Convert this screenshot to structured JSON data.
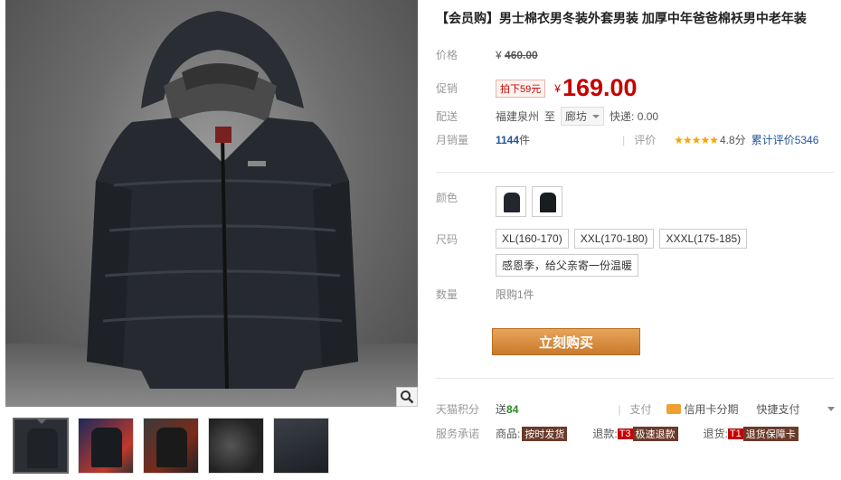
{
  "product": {
    "title": "【会员购】男士棉衣男冬装外套男装 加厚中年爸爸棉袄男中老年装"
  },
  "price": {
    "label": "价格",
    "currency": "¥",
    "original": "460.00"
  },
  "promo": {
    "label": "促销",
    "discount_badge": "拍下59元",
    "currency": "¥",
    "price": "169.00"
  },
  "shipping": {
    "label": "配送",
    "from": "福建泉州",
    "to_word": "至",
    "destination": "廊坊",
    "express": "快递: 0.00"
  },
  "sales": {
    "label": "月销量",
    "count": "1144",
    "unit": "件",
    "review_label": "评价",
    "stars": "★★★★★",
    "rating": "4.8分",
    "review_count": "累计评价5346"
  },
  "color": {
    "label": "颜色"
  },
  "size": {
    "label": "尺码",
    "options": [
      "XL(160-170)",
      "XXL(170-180)",
      "XXXL(175-185)"
    ],
    "extra_option": "感恩季，给父亲寄一份温暖"
  },
  "quantity": {
    "label": "数量",
    "limit": "限购1件"
  },
  "buy_button": "立刻购买",
  "points": {
    "label": "天猫积分",
    "give": "送",
    "amount": "84"
  },
  "payment": {
    "label": "支付",
    "credit": "信用卡分期",
    "quick": "快捷支付"
  },
  "service": {
    "label": "服务承诺",
    "goods": "商品:",
    "goods_tag": "按时发货",
    "refund": "退款:",
    "refund_code": "T3",
    "refund_tag": "极速退款",
    "return": "退货:",
    "return_code": "T1",
    "return_tag": "退货保障卡"
  },
  "colors": {
    "accent": "#c40000",
    "buy_button": "#d8893f",
    "link": "#225599"
  }
}
